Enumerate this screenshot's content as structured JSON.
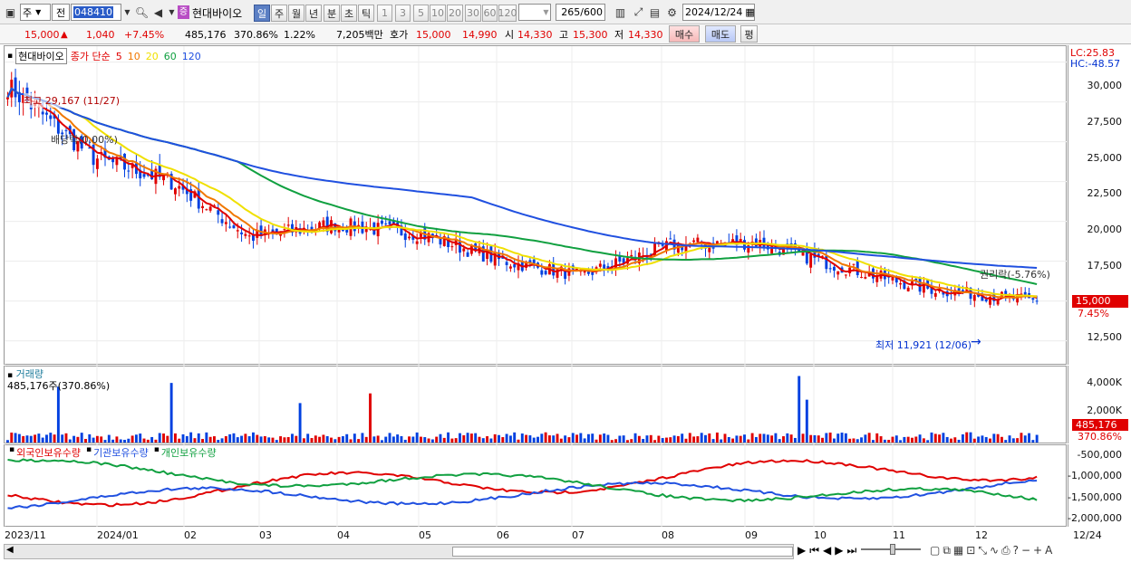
{
  "toolbar": {
    "type_label": "주",
    "jeon_label": "전",
    "code": "048410",
    "stock_name": "현대바이오",
    "stock_badge": "증",
    "periods": [
      "일",
      "주",
      "월",
      "년",
      "분",
      "초",
      "틱"
    ],
    "active_period": "일",
    "intervals": [
      "1",
      "3",
      "5",
      "10",
      "20",
      "30",
      "60",
      "120"
    ],
    "count": "265",
    "count_total": "/600",
    "date": "2024/12/24"
  },
  "quote": {
    "price": "15,000",
    "change": "1,040",
    "change_pct": "+7.45%",
    "volume": "485,176",
    "volume_pct": "370.86%",
    "turnover": "1.22%",
    "amount": "7,205백만",
    "hoga_label": "호가",
    "ask": "15,000",
    "bid": "14,990",
    "open_label": "시",
    "open": "14,330",
    "high_label": "고",
    "high": "15,300",
    "low_label": "저",
    "low": "14,330",
    "buy_label": "매수",
    "sell_label": "매도",
    "eval_label": "평"
  },
  "price_panel": {
    "legend_name": "현대바이오",
    "legend_ma": "종가 단순",
    "ma_periods": [
      {
        "p": "5",
        "color": "#e00000"
      },
      {
        "p": "10",
        "color": "#f07800"
      },
      {
        "p": "20",
        "color": "#f0e000"
      },
      {
        "p": "60",
        "color": "#10a040"
      },
      {
        "p": "120",
        "color": "#2050e0"
      }
    ],
    "lc": "LC:25.83",
    "hc": "HC:-48.57",
    "high_note": "최고 29,167 (11/27)",
    "low_note": "최저 11,921 (12/06)",
    "div_note": "배당락(0.00%)",
    "rights_note": "권리락(-5.76%)",
    "ticks": [
      "30,000",
      "27,500",
      "25,000",
      "22,500",
      "20,000",
      "17,500",
      "15,000",
      "12,500"
    ],
    "current_price": "15,000",
    "current_pct": "7.45%"
  },
  "volume_panel": {
    "title": "거래량",
    "subtitle": "485,176주(370.86%)",
    "ticks": [
      "4,000K",
      "2,000K"
    ],
    "current": "485,176",
    "current_pct": "370.86%"
  },
  "holding_panel": {
    "legend": [
      {
        "label": "외국인보유수량",
        "color": "#e00000"
      },
      {
        "label": "기관보유수량",
        "color": "#2050e0"
      },
      {
        "label": "개인보유수량",
        "color": "#10a040"
      }
    ],
    "ticks": [
      "-500,000",
      "-1,000,000",
      "-1,500,000",
      "-2,000,000"
    ]
  },
  "x_axis": {
    "labels": [
      "2023/11",
      "2024/01",
      "02",
      "03",
      "04",
      "05",
      "06",
      "07",
      "08",
      "09",
      "10",
      "11",
      "12",
      "12/24"
    ]
  },
  "chart_data": {
    "type": "candlestick",
    "x": [
      "2023/11",
      "2024/01",
      "02",
      "03",
      "04",
      "05",
      "06",
      "07",
      "08",
      "09",
      "10",
      "11",
      "12"
    ],
    "close": [
      28500,
      24000,
      22500,
      19000,
      19800,
      19200,
      17500,
      16600,
      18500,
      18700,
      17200,
      15800,
      15000
    ],
    "ylim": [
      11000,
      31000
    ],
    "volume_ylim": [
      0,
      4800000
    ],
    "ma": [
      "5",
      "10",
      "20",
      "60",
      "120"
    ]
  }
}
